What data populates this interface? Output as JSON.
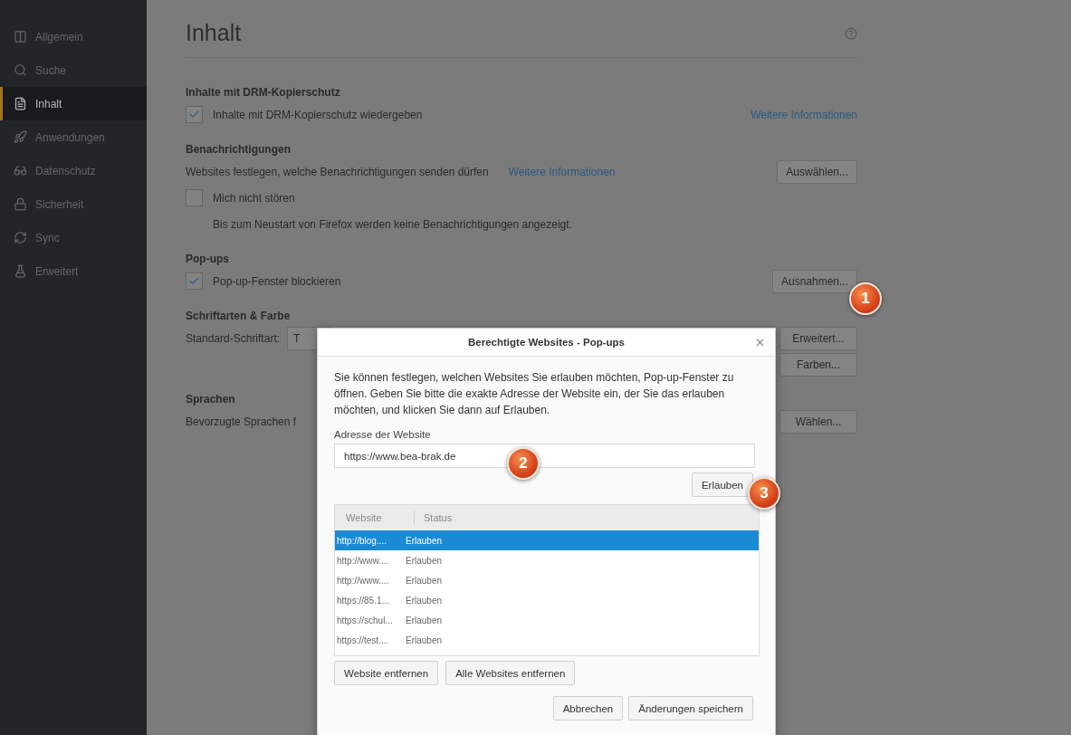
{
  "sidebar": {
    "items": [
      {
        "label": "Allgemein",
        "selected": false
      },
      {
        "label": "Suche",
        "selected": false
      },
      {
        "label": "Inhalt",
        "selected": true
      },
      {
        "label": "Anwendungen",
        "selected": false
      },
      {
        "label": "Datenschutz",
        "selected": false
      },
      {
        "label": "Sicherheit",
        "selected": false
      },
      {
        "label": "Sync",
        "selected": false
      },
      {
        "label": "Erweitert",
        "selected": false
      }
    ]
  },
  "main": {
    "title": "Inhalt",
    "sections": [
      {
        "heading": "Inhalte mit DRM-Kopierschutz",
        "rows": [
          {
            "kind": "checkbox",
            "label": "Inhalte mit DRM-Kopierschutz wiedergeben",
            "checked": true,
            "link": "Weitere Informationen"
          }
        ]
      },
      {
        "heading": "Benachrichtigungen",
        "rows": [
          {
            "kind": "text",
            "text": "Websites festlegen, welche Benachrichtigungen senden dürfen",
            "link": "Weitere Informationen",
            "button": "Auswählen..."
          },
          {
            "kind": "checkbox",
            "label": "Mich nicht stören",
            "checked": false
          },
          {
            "kind": "note",
            "text": "Bis zum Neustart von Firefox werden keine Benachrichtigungen angezeigt."
          }
        ]
      },
      {
        "heading": "Pop-ups",
        "rows": [
          {
            "kind": "checkbox",
            "label": "Pop-up-Fenster blockieren",
            "checked": true,
            "button": "Ausnahmen..."
          }
        ]
      },
      {
        "heading": "Schriftarten & Farbe",
        "rows": [
          {
            "kind": "select",
            "label": "Standard-Schriftart:",
            "value": "T",
            "button": "Erweitert..."
          },
          {
            "kind": "button",
            "button": "Farben..."
          }
        ]
      },
      {
        "heading": "Sprachen",
        "rows": [
          {
            "kind": "text",
            "text": "Bevorzugte Sprachen f",
            "button": "Wählen..."
          }
        ]
      }
    ]
  },
  "dialog": {
    "title": "Berechtigte Websites - Pop-ups",
    "description": "Sie können festlegen, welchen Websites Sie erlauben möchten, Pop-up-Fenster zu öffnen. Geben Sie bitte die exakte Adresse der Website ein, der Sie das erlauben möchten, und klicken Sie dann auf Erlauben.",
    "address_label": "Adresse der Website",
    "address_value": "https://www.bea-brak.de",
    "allow_button": "Erlauben",
    "table": {
      "columns": [
        "Website",
        "Status"
      ],
      "rows": [
        {
          "website": "http://blog....",
          "status": "Erlauben",
          "selected": true
        },
        {
          "website": "http://www....",
          "status": "Erlauben",
          "selected": false
        },
        {
          "website": "http://www....",
          "status": "Erlauben",
          "selected": false
        },
        {
          "website": "https://85.1...",
          "status": "Erlauben",
          "selected": false
        },
        {
          "website": "https://schul...",
          "status": "Erlauben",
          "selected": false
        },
        {
          "website": "https://test....",
          "status": "Erlauben",
          "selected": false
        }
      ]
    },
    "remove_buttons": [
      "Website entfernen",
      "Alle Websites entfernen"
    ],
    "footer_buttons": [
      "Abbrechen",
      "Änderungen speichern"
    ]
  },
  "callouts": [
    {
      "label": "1"
    },
    {
      "label": "2"
    },
    {
      "label": "3"
    }
  ]
}
